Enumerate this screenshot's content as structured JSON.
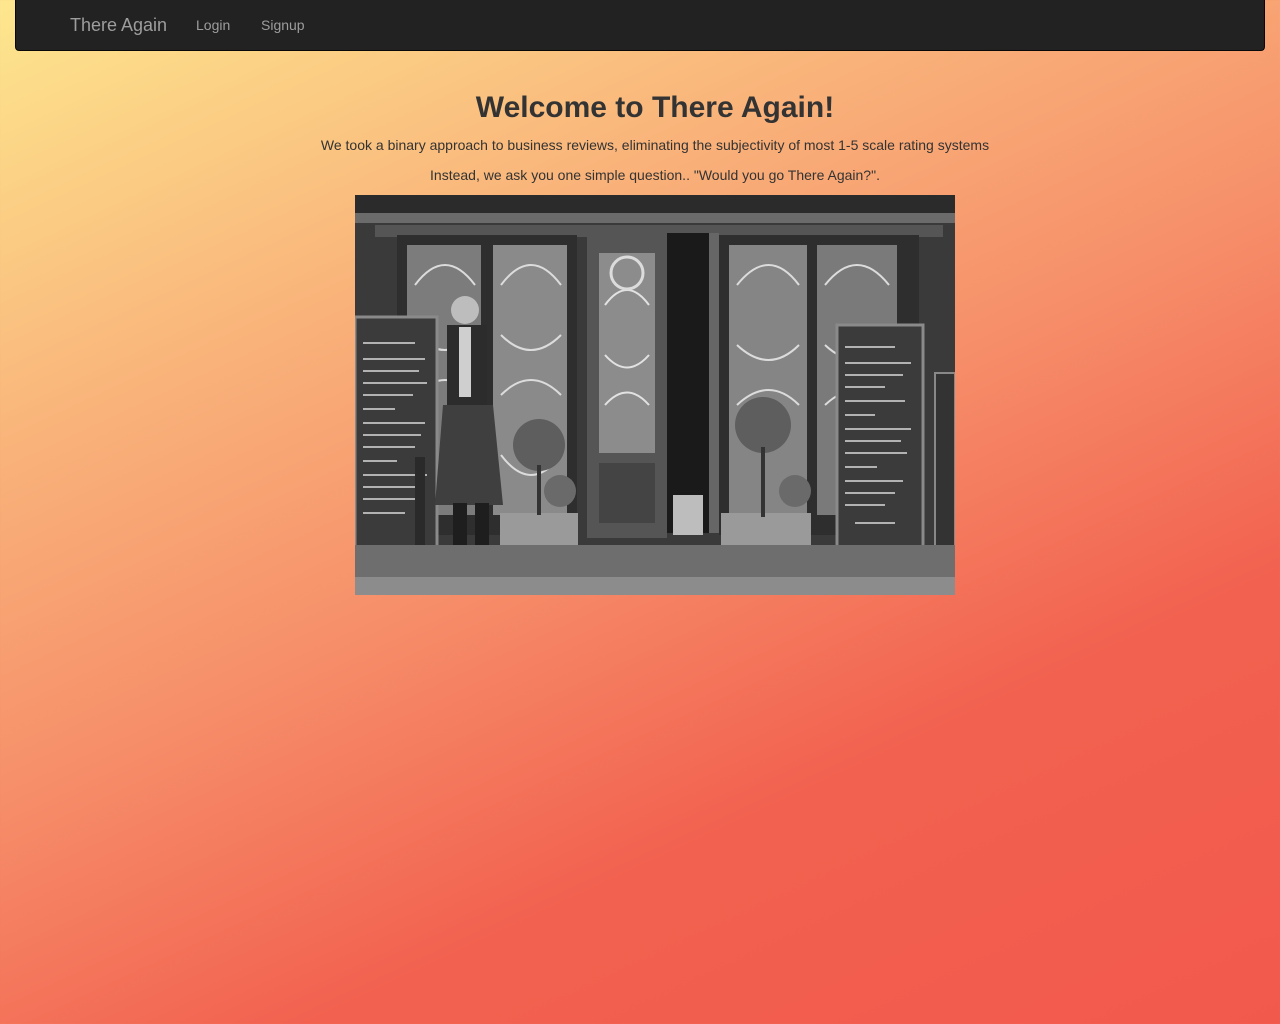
{
  "navbar": {
    "brand": "There Again",
    "links": [
      "Login",
      "Signup"
    ]
  },
  "main": {
    "heading": "Welcome to There Again!",
    "paragraphs": [
      "We took a binary approach to business reviews, eliminating the subjectivity of most 1-5 scale rating systems",
      "Instead, we ask you one simple question.. \"Would you go There Again?\"."
    ]
  },
  "colors": {
    "navbar_bg": "#222222",
    "nav_text": "#9d9d9d",
    "gradient_start": "#fde78e",
    "gradient_end": "#f2594d",
    "text": "#333333"
  }
}
